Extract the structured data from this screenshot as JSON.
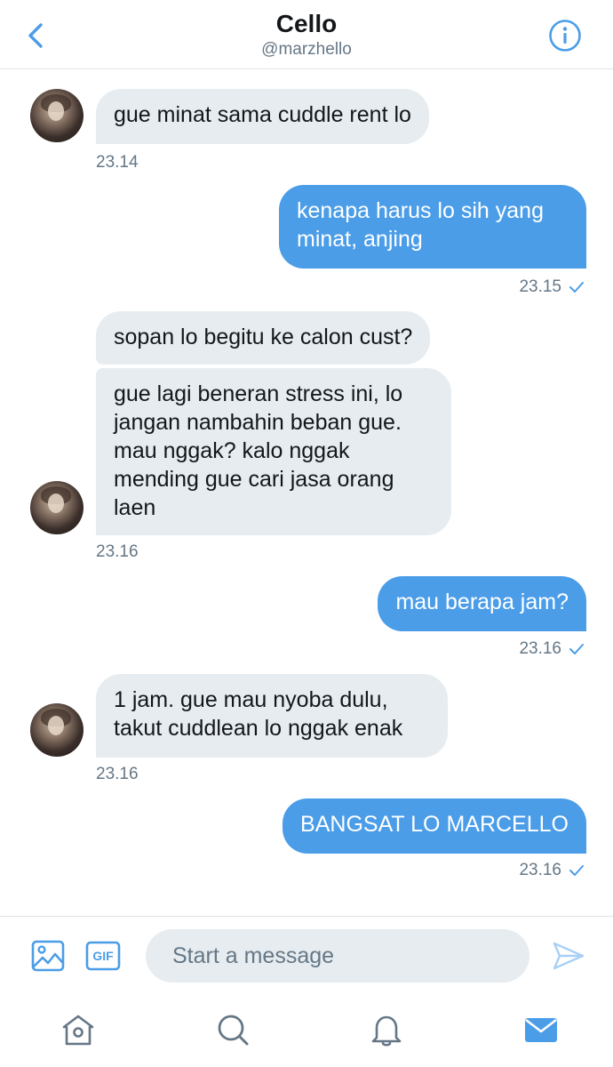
{
  "header": {
    "title": "Cello",
    "handle": "@marzhello"
  },
  "messages": [
    {
      "direction": "incoming",
      "text": "gue minat sama cuddle rent lo",
      "time": "23.14"
    },
    {
      "direction": "outgoing",
      "text": "kenapa harus lo sih yang\nminat, anjing",
      "time": "23.15",
      "read": true
    },
    {
      "direction": "incoming",
      "text": "sopan lo begitu ke calon cust?"
    },
    {
      "direction": "incoming",
      "text": "gue lagi beneran stress ini, lo\njangan nambahin beban gue.\nmau nggak? kalo nggak\nmending gue cari jasa orang\nlaen",
      "time": "23.16"
    },
    {
      "direction": "outgoing",
      "text": "mau berapa jam?",
      "time": "23.16",
      "read": true
    },
    {
      "direction": "incoming",
      "text": "1 jam. gue mau nyoba dulu,\ntakut cuddlean lo nggak enak",
      "time": "23.16"
    },
    {
      "direction": "outgoing",
      "text": "BANGSAT LO MARCELLO",
      "time": "23.16",
      "read": true
    }
  ],
  "composer": {
    "placeholder": "Start a message",
    "value": "",
    "gif_label": "GIF"
  },
  "icons": {
    "back": "chevron-left-icon",
    "info": "info-icon",
    "media": "image-icon",
    "gif": "gif-icon",
    "send": "send-icon",
    "tabs": [
      "home-icon",
      "search-icon",
      "bell-icon",
      "mail-icon"
    ]
  },
  "colors": {
    "accent": "#4b9de8",
    "incoming_bubble": "#e6ecf0",
    "muted_text": "#657786",
    "active_tab": "#4b9de8",
    "inactive_tab": "#657786"
  }
}
